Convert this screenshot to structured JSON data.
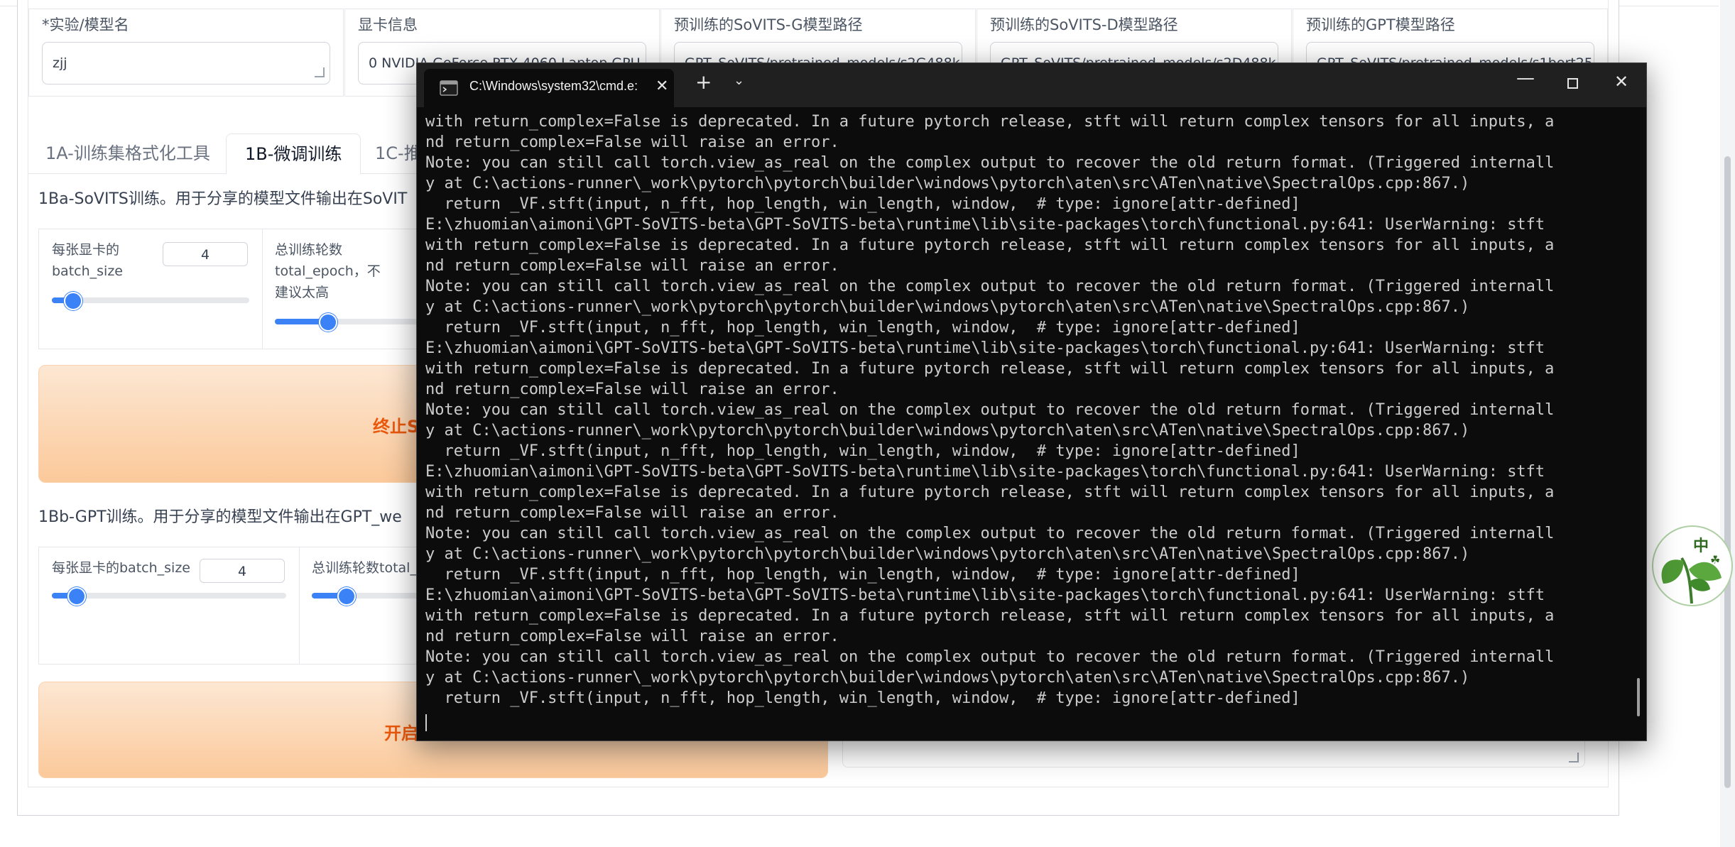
{
  "form": {
    "experiment_label": "*实验/模型名",
    "experiment_value": "zjj",
    "gpu_label": "显卡信息",
    "gpu_value": "0  NVIDIA GeForce RTX 4060 Laptop GPU",
    "sovits_g_label": "预训练的SoVITS-G模型路径",
    "sovits_g_value": "GPT_SoVITS/pretrained_models/s2G488k.pth",
    "sovits_d_label": "预训练的SoVITS-D模型路径",
    "sovits_d_value": "GPT_SoVITS/pretrained_models/s2D488k.pth",
    "gpt_label": "预训练的GPT模型路径",
    "gpt_value": "GPT_SoVITS/pretrained_models/s1bert25hz"
  },
  "tabs": [
    "1A-训练集格式化工具",
    "1B-微调训练",
    "1C-推"
  ],
  "sovits": {
    "title": "1Ba-SoVITS训练。用于分享的模型文件输出在SoVIT",
    "batch_label": "每张显卡的\nbatch_size",
    "batch_value": "4",
    "batch_level": 0.1,
    "epoch_label": "总训练轮数\ntotal_epoch，不\n建议太高",
    "epoch_level": 0.35,
    "button_label": "终止S"
  },
  "gpt": {
    "title": "1Bb-GPT训练。用于分享的模型文件输出在GPT_we",
    "batch_label": "每张显卡的batch_size",
    "batch_value": "4",
    "batch_level": 0.1,
    "epoch_label": "总训练轮数total_",
    "epoch_level": 0.3,
    "button_label": "开启"
  },
  "badge": {
    "text": "中",
    "icon": "tea-leaf-logo-icon"
  },
  "terminal": {
    "title": "C:\\Windows\\system32\\cmd.e:",
    "lines": [
      "with return_complex=False is deprecated. In a future pytorch release, stft will return complex tensors for all inputs, a",
      "nd return_complex=False will raise an error.",
      "Note: you can still call torch.view_as_real on the complex output to recover the old return format. (Triggered internall",
      "y at C:\\actions-runner\\_work\\pytorch\\pytorch\\builder\\windows\\pytorch\\aten\\src\\ATen\\native\\SpectralOps.cpp:867.)",
      "  return _VF.stft(input, n_fft, hop_length, win_length, window,  # type: ignore[attr-defined]",
      "E:\\zhuomian\\aimoni\\GPT-SoVITS-beta\\GPT-SoVITS-beta\\runtime\\lib\\site-packages\\torch\\functional.py:641: UserWarning: stft",
      "with return_complex=False is deprecated. In a future pytorch release, stft will return complex tensors for all inputs, a",
      "nd return_complex=False will raise an error.",
      "Note: you can still call torch.view_as_real on the complex output to recover the old return format. (Triggered internall",
      "y at C:\\actions-runner\\_work\\pytorch\\pytorch\\builder\\windows\\pytorch\\aten\\src\\ATen\\native\\SpectralOps.cpp:867.)",
      "  return _VF.stft(input, n_fft, hop_length, win_length, window,  # type: ignore[attr-defined]",
      "E:\\zhuomian\\aimoni\\GPT-SoVITS-beta\\GPT-SoVITS-beta\\runtime\\lib\\site-packages\\torch\\functional.py:641: UserWarning: stft",
      "with return_complex=False is deprecated. In a future pytorch release, stft will return complex tensors for all inputs, a",
      "nd return_complex=False will raise an error.",
      "Note: you can still call torch.view_as_real on the complex output to recover the old return format. (Triggered internall",
      "y at C:\\actions-runner\\_work\\pytorch\\pytorch\\builder\\windows\\pytorch\\aten\\src\\ATen\\native\\SpectralOps.cpp:867.)",
      "  return _VF.stft(input, n_fft, hop_length, win_length, window,  # type: ignore[attr-defined]",
      "E:\\zhuomian\\aimoni\\GPT-SoVITS-beta\\GPT-SoVITS-beta\\runtime\\lib\\site-packages\\torch\\functional.py:641: UserWarning: stft",
      "with return_complex=False is deprecated. In a future pytorch release, stft will return complex tensors for all inputs, a",
      "nd return_complex=False will raise an error.",
      "Note: you can still call torch.view_as_real on the complex output to recover the old return format. (Triggered internall",
      "y at C:\\actions-runner\\_work\\pytorch\\pytorch\\builder\\windows\\pytorch\\aten\\src\\ATen\\native\\SpectralOps.cpp:867.)",
      "  return _VF.stft(input, n_fft, hop_length, win_length, window,  # type: ignore[attr-defined]",
      "E:\\zhuomian\\aimoni\\GPT-SoVITS-beta\\GPT-SoVITS-beta\\runtime\\lib\\site-packages\\torch\\functional.py:641: UserWarning: stft",
      "with return_complex=False is deprecated. In a future pytorch release, stft will return complex tensors for all inputs, a",
      "nd return_complex=False will raise an error.",
      "Note: you can still call torch.view_as_real on the complex output to recover the old return format. (Triggered internall",
      "y at C:\\actions-runner\\_work\\pytorch\\pytorch\\builder\\windows\\pytorch\\aten\\src\\ATen\\native\\SpectralOps.cpp:867.)",
      "  return _VF.stft(input, n_fft, hop_length, win_length, window,  # type: ignore[attr-defined]"
    ]
  },
  "colors": {
    "accent": "#3b82f6",
    "button_text": "#ea580c",
    "terminal_bg": "#0c0c0c",
    "terminal_text": "#cccccc"
  }
}
